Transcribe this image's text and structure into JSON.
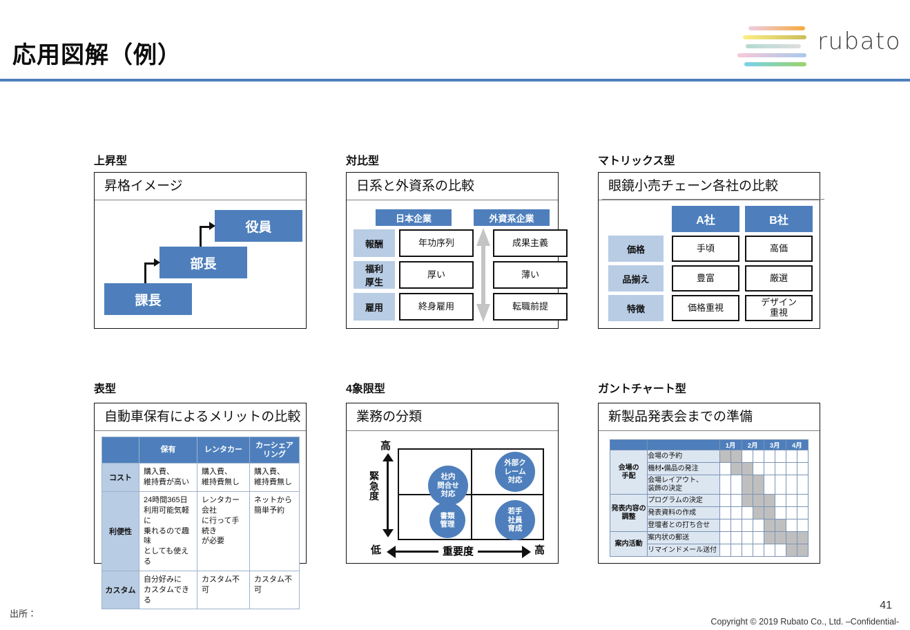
{
  "header": {
    "title": "応用図解（例）",
    "rule_color": "#4E7FBC",
    "logo_text": "rubato",
    "logo_bar_colors": [
      "#e8c8e0,#f4a83a",
      "#fbe87a,#cfc060",
      "#b8d9d2,#dcdcdc",
      "#f7c6d6,#aac9e8",
      "#7fd0e8,#9ad06a"
    ]
  },
  "theme": {
    "accent_blue": "#4E7FBC",
    "light_blue": "#B8CCE4",
    "pale_blue": "#DCE6F1",
    "gantt_fill": "#BFBFBF",
    "rule_gray": "#7F7F7F"
  },
  "panels": {
    "rising": {
      "label": "上昇型",
      "title": "昇格イメージ",
      "steps": [
        "課長",
        "部長",
        "役員"
      ]
    },
    "contrast": {
      "label": "対比型",
      "title": "日系と外資系の比較",
      "columns": [
        "日本企業",
        "外資系企業"
      ],
      "rows": [
        {
          "label": "報酬",
          "values": [
            "年功序列",
            "成果主義"
          ]
        },
        {
          "label": "福利\n厚生",
          "values": [
            "厚い",
            "薄い"
          ]
        },
        {
          "label": "雇用",
          "values": [
            "終身雇用",
            "転職前提"
          ]
        }
      ]
    },
    "matrix": {
      "label": "マトリックス型",
      "title": "眼鏡小売チェーン各社の比較",
      "columns": [
        "A社",
        "B社"
      ],
      "rows": [
        {
          "label": "価格",
          "values": [
            "手頃",
            "高価"
          ]
        },
        {
          "label": "品揃え",
          "values": [
            "豊富",
            "厳選"
          ]
        },
        {
          "label": "特徴",
          "values": [
            "価格重視",
            "デザイン\n重視"
          ]
        }
      ]
    },
    "table": {
      "label": "表型",
      "title": "自動車保有によるメリットの比較",
      "columns": [
        "",
        "保有",
        "レンタカー",
        "カーシェア\nリング"
      ],
      "rows": [
        {
          "label": "コスト",
          "cells": [
            "購入費、\n維持費が高い",
            "購入費、\n維持費無し",
            "購入費、\n維持費無し"
          ]
        },
        {
          "label": "利便性",
          "cells": [
            "24時間365日\n利用可能気軽に\n乗れるので趣味\nとしても使える",
            "レンタカー会社\nに行って手続き\nが必要",
            "ネットから\n簡単予約"
          ]
        },
        {
          "label": "カスタム",
          "cells": [
            "自分好みに\nカスタムできる",
            "カスタム不可",
            "カスタム不可"
          ]
        }
      ]
    },
    "quadrant": {
      "label": "4象限型",
      "title": "業務の分類",
      "y_axis": {
        "name": "緊急度",
        "high": "高",
        "low": "低"
      },
      "x_axis": {
        "name": "重要度",
        "high": "高",
        "low": "低"
      },
      "bubbles": [
        {
          "lines": [
            "社内",
            "問合せ",
            "対応"
          ]
        },
        {
          "lines": [
            "外部ク",
            "レーム",
            "対応"
          ]
        },
        {
          "lines": [
            "書類",
            "管理"
          ]
        },
        {
          "lines": [
            "若手",
            "社員",
            "育成"
          ]
        }
      ]
    },
    "gantt": {
      "label": "ガントチャート型",
      "title": "新製品発表会までの準備",
      "months": [
        "1月",
        "2月",
        "3月",
        "4月"
      ],
      "groups": [
        {
          "name": "会場の\n手配",
          "tasks": [
            {
              "name": "会場の予約",
              "fill": [
                1,
                1,
                0,
                0,
                0,
                0,
                0,
                0
              ]
            },
            {
              "name": "機材・備品の発注",
              "fill": [
                0,
                1,
                1,
                0,
                0,
                0,
                0,
                0
              ]
            },
            {
              "name": "会場レイアウト、\n装飾の決定",
              "fill": [
                0,
                0,
                1,
                1,
                0,
                0,
                0,
                0
              ]
            }
          ]
        },
        {
          "name": "発表内容の\n調整",
          "tasks": [
            {
              "name": "プログラムの決定",
              "fill": [
                0,
                0,
                1,
                1,
                1,
                0,
                0,
                0
              ]
            },
            {
              "name": "発表資料の作成",
              "fill": [
                0,
                0,
                0,
                1,
                1,
                0,
                0,
                0
              ]
            },
            {
              "name": "登壇者との打ち合せ",
              "fill": [
                0,
                0,
                0,
                0,
                1,
                1,
                0,
                0
              ]
            }
          ]
        },
        {
          "name": "案内活動",
          "tasks": [
            {
              "name": "案内状の郵送",
              "fill": [
                0,
                0,
                0,
                0,
                1,
                1,
                1,
                1
              ]
            },
            {
              "name": "リマインドメール送付",
              "fill": [
                0,
                0,
                0,
                0,
                0,
                0,
                1,
                1
              ]
            }
          ]
        }
      ]
    }
  },
  "footer": {
    "source_label": "出所：",
    "page_number": "41",
    "copyright": "Copyright © 2019 Rubato Co., Ltd. –Confidential-"
  }
}
